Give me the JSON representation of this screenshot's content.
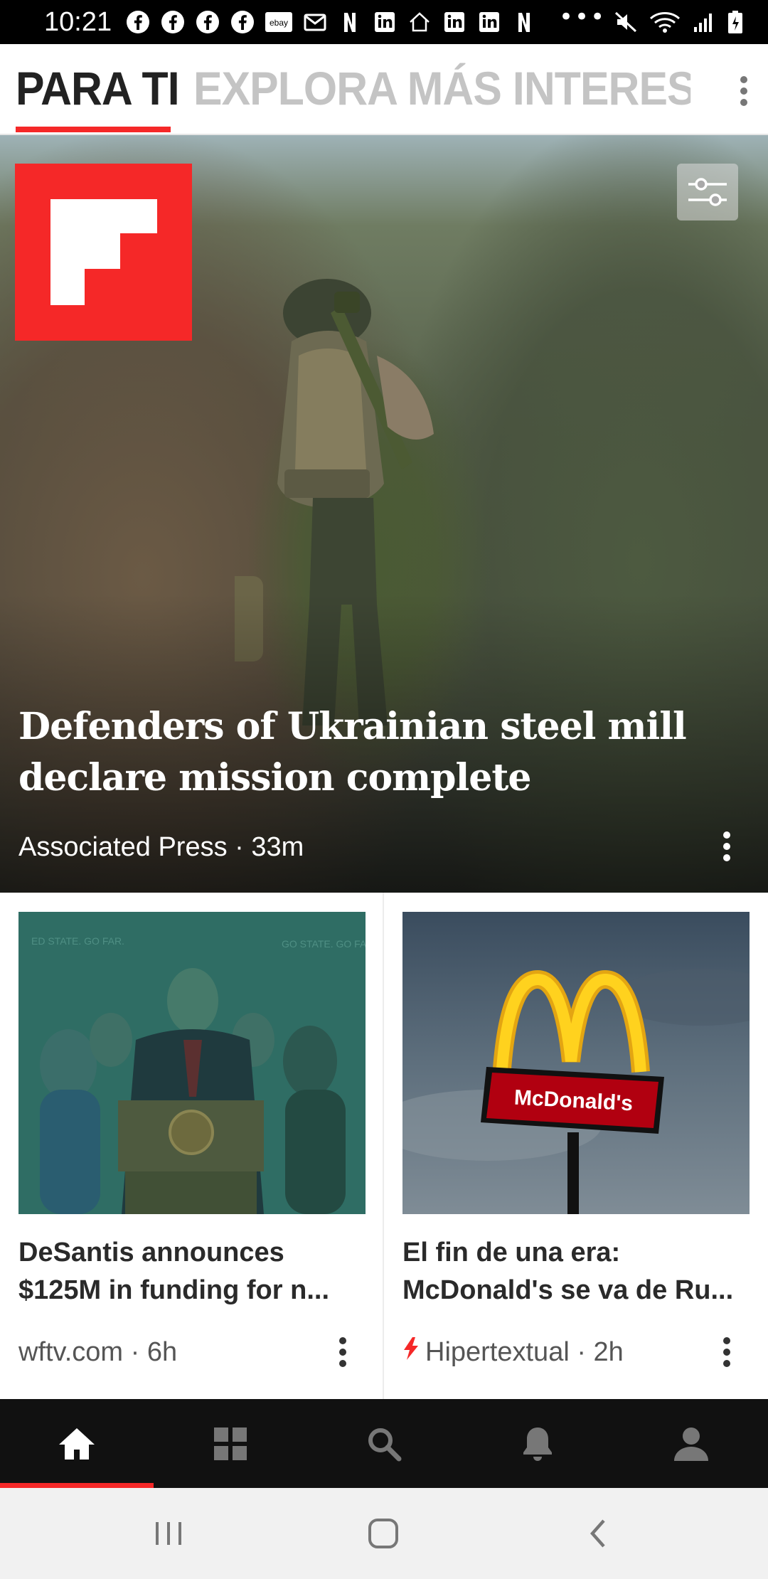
{
  "status_bar": {
    "time": "10:21",
    "left_icons": [
      "facebook-icon",
      "facebook-icon",
      "facebook-icon",
      "facebook-icon",
      "ebay-icon",
      "mail-icon",
      "netflix-icon",
      "linkedin-icon",
      "home-icon",
      "linkedin-icon",
      "linkedin-icon",
      "netflix-icon"
    ],
    "ebay_label": "ebay",
    "more": "•••",
    "right_icons": [
      "mute-icon",
      "wifi-icon",
      "signal-icon",
      "battery-icon"
    ]
  },
  "tabs": {
    "active": "PARA TI",
    "inactive": "EXPLORA MÁS INTERESES"
  },
  "colors": {
    "accent": "#f52828",
    "nav_background": "#111111",
    "nav_icon": "#777777",
    "nav_icon_active": "#ffffff"
  },
  "hero": {
    "title": "Defenders of Ukrainian steel mill declare mission complete",
    "source": "Associated Press",
    "age": "33m",
    "meta": "Associated Press · 33m"
  },
  "cards": [
    {
      "title": "DeSantis announces $125M in funding for n...",
      "meta": "wftv.com · 6h",
      "image_signs": [
        "ED STATE. GO FAR.",
        "GO STATE. GO FA"
      ]
    },
    {
      "title": "El fin de una era: McDonald's se va de Ru...",
      "meta": "Hipertextual · 2h",
      "image_sign": "McDonald's"
    }
  ],
  "bottom_nav": {
    "items": [
      "home-icon",
      "grid-icon",
      "search-icon",
      "bell-icon",
      "profile-icon"
    ],
    "active": "home-icon"
  },
  "system_nav": [
    "recent-apps-icon",
    "home-button-icon",
    "back-icon"
  ]
}
